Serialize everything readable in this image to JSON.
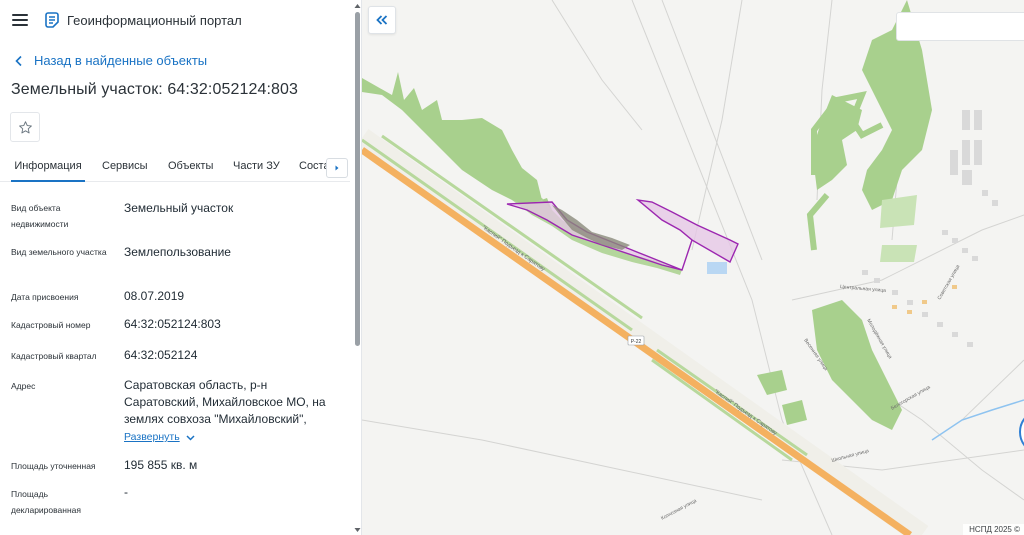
{
  "app": {
    "title": "Геоинформационный портал"
  },
  "nav": {
    "back_label": "Назад в найденные объекты"
  },
  "object": {
    "title": "Земельный участок: 64:32:052124:803"
  },
  "tabs": [
    {
      "label": "Информация",
      "active": true
    },
    {
      "label": "Сервисы",
      "active": false
    },
    {
      "label": "Объекты",
      "active": false
    },
    {
      "label": "Части ЗУ",
      "active": false
    },
    {
      "label": "Состав",
      "active": false
    }
  ],
  "properties": {
    "object_type": {
      "label": "Вид объекта недвижимости",
      "value": "Земельный участок"
    },
    "land_type": {
      "label": "Вид земельного участка",
      "value": "Землепользование"
    },
    "assigned_date": {
      "label": "Дата присвоения",
      "value": "08.07.2019"
    },
    "cadastral_number": {
      "label": "Кадастровый номер",
      "value": "64:32:052124:803"
    },
    "cadastral_quarter": {
      "label": "Кадастровый квартал",
      "value": "64:32:052124"
    },
    "address": {
      "label": "Адрес",
      "value": "Саратовская область, р-н Саратовский, Михайловское МО, на землях совхоза \"Михайловский\",",
      "expand_label": "Развернуть"
    },
    "area_specified": {
      "label": "Площадь уточненная",
      "value": "195 855 кв. м"
    },
    "area_declared": {
      "label": "Площадь декларированная",
      "value": "-"
    }
  },
  "map": {
    "road_label": "\"Каспий\" Подъезд к Саратову",
    "road_number": "Р-22",
    "streets": [
      "Центральная улица",
      "Советская улица",
      "Молодёжная улица",
      "Весенняя улица",
      "Белогорская улица",
      "Колхозная улица",
      "Школьная улица"
    ],
    "attribution": "НСПД 2025 ©",
    "search_placeholder": ""
  },
  "colors": {
    "accent": "#1a73c4",
    "parcel_fill": "#e6c6e6",
    "parcel_stroke": "#9c27b0",
    "road": "#f4b160",
    "vegetation": "#a8d08d"
  },
  "icons": {
    "menu": "hamburger-icon",
    "logo": "portal-logo-icon",
    "back": "chevron-left-icon",
    "favorite": "star-icon",
    "tabs_next": "chevron-right-icon",
    "expand": "chevron-down-icon",
    "collapse": "double-chevron-left-icon"
  }
}
